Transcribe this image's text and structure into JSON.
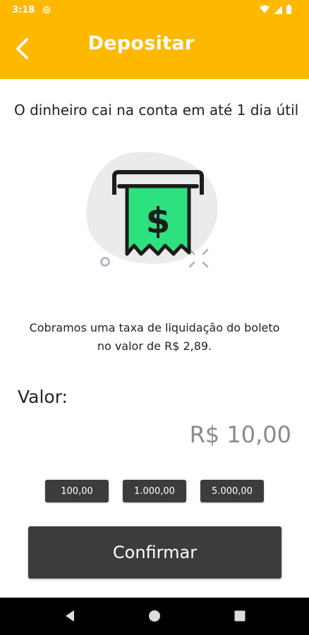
{
  "status_bar": {
    "time": "3:18",
    "icons": [
      "gear-icon",
      "wifi-icon",
      "signal-icon",
      "battery-icon"
    ]
  },
  "header": {
    "title": "Depositar",
    "back_icon": "chevron-left-icon",
    "background": "#ffb800"
  },
  "main": {
    "intro_text": "O dinheiro cai na conta em até 1 dia útil",
    "illustration": "boleto-dollar-icon",
    "fee_text": "Cobramos uma taxa de liquidação do boleto no valor de R$ 2,89.",
    "valor_label": "Valor:",
    "amount": "R$ 10,00",
    "quick_amounts": [
      "100,00",
      "1.000,00",
      "5.000,00"
    ],
    "confirm_label": "Confirmar"
  },
  "nav_bar": {
    "buttons": [
      "back-triangle-icon",
      "home-circle-icon",
      "recents-square-icon"
    ]
  },
  "colors": {
    "accent": "#ffb800",
    "button": "#3c3c3c",
    "illustration_green": "#2ee17f"
  }
}
